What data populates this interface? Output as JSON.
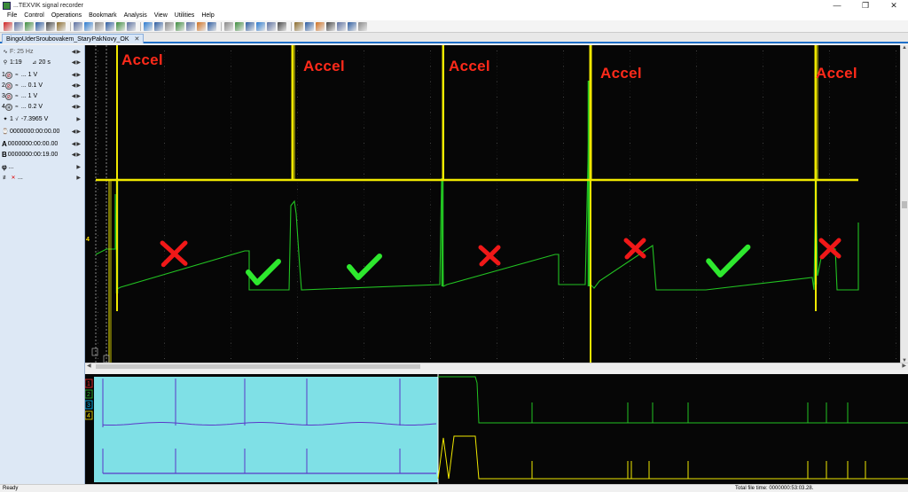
{
  "window": {
    "title": "...TEXVIK  signal recorder",
    "minimize_glyph": "—",
    "maximize_glyph": "❐",
    "close_glyph": "✕",
    "app_icon": "oscilloscope-app-icon"
  },
  "menu": [
    "File",
    "Control",
    "Operations",
    "Bookmark",
    "Analysis",
    "View",
    "Utilities",
    "Help"
  ],
  "tab": {
    "label": "BingoUderSroubovakem_StaryPakNovy_OK",
    "close_glyph": "✕"
  },
  "left_panel": {
    "frequency": "F: 25 Hz",
    "zoom": "1:19",
    "time_div": "20 s",
    "channels": [
      {
        "num": "1",
        "value": "... 1 V"
      },
      {
        "num": "2",
        "value": "... 0.1 V"
      },
      {
        "num": "3",
        "value": "... 1 V"
      },
      {
        "num": "4",
        "value": "... 0.2 V"
      }
    ],
    "measure": "-7.3965 V",
    "measure_channel": "1",
    "time_cursor": "0000000:00:00.00",
    "cursor_a_label": "A",
    "cursor_a": "0000000:00:00.00",
    "cursor_b_label": "B",
    "cursor_b": "0000000:00:19.00",
    "phi_label": "φ",
    "phi_value": "...",
    "extra_value": "..."
  },
  "scope": {
    "annotations": [
      "Accel",
      "Accel",
      "Accel",
      "Accel",
      "Accel"
    ],
    "channel_marker": "4",
    "marks": [
      "cross",
      "check",
      "check",
      "cross",
      "cross",
      "check",
      "cross"
    ]
  },
  "overview": {
    "channel_labels": [
      "1",
      "2",
      "3",
      "4"
    ]
  },
  "status": {
    "left": "Ready",
    "right": "Total file time: 0000000:53:03.28."
  },
  "colors": {
    "trace_yellow": "#f0e800",
    "trace_green": "#22c322",
    "annotation_red": "#ff2a1a",
    "mark_red": "#f01818",
    "mark_green": "#2ee82e",
    "overview_selection": "#7fe0e6",
    "overview_trace": "#5a38c8"
  }
}
